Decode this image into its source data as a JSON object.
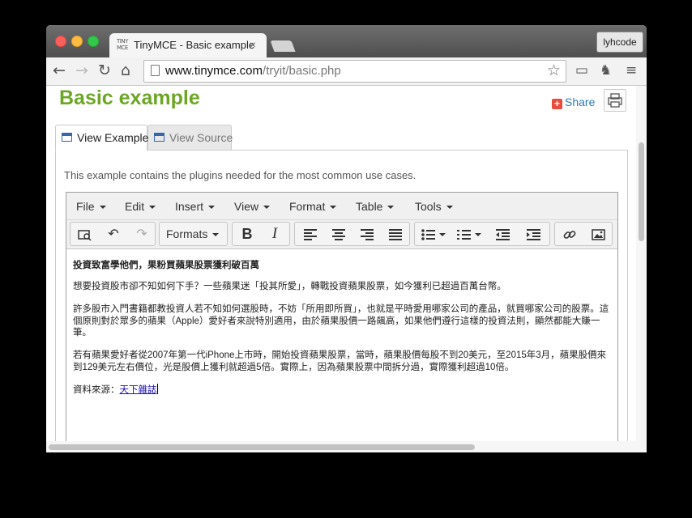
{
  "browser": {
    "tab_title": "TinyMCE - Basic example",
    "tab_logo_text": "TINY MCE",
    "tab_close": "×",
    "profile_button": "lyhcode",
    "url_host": "www.tinymce.com",
    "url_path": "/tryit/basic.php",
    "icons": {
      "back": "back-arrow-icon",
      "forward": "forward-arrow-icon",
      "reload": "reload-icon",
      "home": "home-icon",
      "star": "bookmark-star-icon",
      "cast": "cast-icon",
      "extension": "evernote-icon",
      "menu": "hamburger-menu-icon"
    }
  },
  "page": {
    "title": "Basic example",
    "share_label": "Share",
    "tabs": [
      {
        "label": "View Example",
        "active": true
      },
      {
        "label": "View Source",
        "active": false
      }
    ],
    "description": "This example contains the plugins needed for the most common use cases."
  },
  "editor": {
    "menubar": [
      "File",
      "Edit",
      "Insert",
      "View",
      "Format",
      "Table",
      "Tools"
    ],
    "formats_label": "Formats",
    "toolbar_icons": [
      "search-replace-icon",
      "undo-icon",
      "redo-icon",
      "bold-icon",
      "italic-icon",
      "align-left-icon",
      "align-center-icon",
      "align-right-icon",
      "align-justify-icon",
      "bullet-list-icon",
      "numbered-list-icon",
      "outdent-icon",
      "indent-icon",
      "link-icon",
      "image-icon"
    ],
    "bold_glyph": "B",
    "italic_glyph": "I",
    "content": {
      "heading": "投資致富學他們，果粉買蘋果股票獲利破百萬",
      "p1": "想要投資股市卻不知如何下手？一些蘋果迷「投其所愛」，轉戰投資蘋果股票，如今獲利已超過百萬台幣。",
      "p2": "許多股市入門書籍都教投資人若不知如何選股時，不妨「所用即所買」，也就是平時愛用哪家公司的產品，就買哪家公司的股票。這個原則對於眾多的蘋果（Apple）愛好者來說特別適用，由於蘋果股價一路飆高，如果他們遵行這樣的投資法則，顯然都能大賺一筆。",
      "p3": "若有蘋果愛好者從2007年第一代iPhone上市時，開始投資蘋果股票，當時，蘋果股價每股不到20美元，至2015年3月，蘋果股價來到129美元左右價位，光是股價上獲利就超過5倍。實際上，因為蘋果股票中間拆分過，實際獲利超過10倍。",
      "source_label": "資料來源：",
      "source_link": "天下雜誌"
    }
  }
}
